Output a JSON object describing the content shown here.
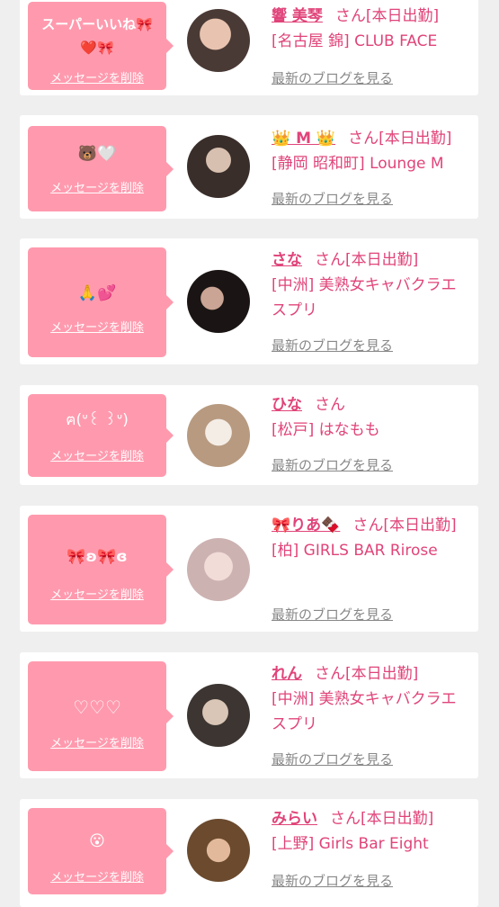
{
  "cards": [
    {
      "name": "響 美琴",
      "suffix": "さん[本日出勤]",
      "shop": "[名古屋 錦] CLUB FACE",
      "message": "スーパーいいね🎀❤️🎀",
      "delete": "メッセージを削除",
      "blog": "最新のブログを見る"
    },
    {
      "name": "👑 M 👑",
      "suffix": "さん[本日出勤]",
      "shop": "[静岡 昭和町] Lounge M",
      "message": "🐻🤍",
      "delete": "メッセージを削除",
      "blog": "最新のブログを見る"
    },
    {
      "name": "さな",
      "suffix": "さん[本日出勤]",
      "shop": "[中洲] 美熟女キャバクラエスプリ",
      "message": "🙏💕",
      "delete": "メッセージを削除",
      "blog": "最新のブログを見る"
    },
    {
      "name": "ひな",
      "suffix": "さん",
      "shop": "[松戸] はなもも",
      "message": "ฅ(ᐡ꒰ ꒱ᐡ)",
      "delete": "メッセージを削除",
      "blog": "最新のブログを見る"
    },
    {
      "name": "🎀りあ🍫",
      "suffix": "さん[本日出勤]",
      "shop": "[柏] GIRLS BAR Rirose",
      "message": "🎀ʚ🎀ɞ",
      "delete": "メッセージを削除",
      "blog": "最新のブログを見る"
    },
    {
      "name": "れん",
      "suffix": "さん[本日出勤]",
      "shop": "[中洲] 美熟女キャバクラエスプリ",
      "message": "♡♡♡",
      "delete": "メッセージを削除",
      "blog": "最新のブログを見る"
    },
    {
      "name": "みらい",
      "suffix": "さん[本日出勤]",
      "shop": "[上野] Girls Bar Eight",
      "message": "😮",
      "delete": "メッセージを削除",
      "blog": "最新のブログを見る"
    }
  ],
  "colors": {
    "accent": "#e0447a",
    "bubble": "#ff9aae",
    "card": "#ffffff",
    "bg": "#efefef",
    "link": "#888888"
  }
}
